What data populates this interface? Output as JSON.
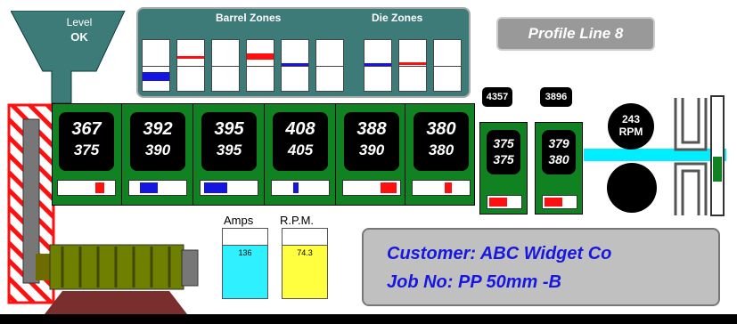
{
  "hopper": {
    "label": "Level",
    "status": "OK"
  },
  "zones_panel": {
    "barrel_label": "Barrel Zones",
    "die_label": "Die Zones"
  },
  "title": "Profile Line 8",
  "barrel_zones": [
    {
      "actual": "367",
      "setpoint": "375",
      "output_level": 0.12
    },
    {
      "actual": "392",
      "setpoint": "390",
      "output_level": 0.3
    },
    {
      "actual": "395",
      "setpoint": "395",
      "output_level": 0.38
    },
    {
      "actual": "408",
      "setpoint": "405",
      "output_level": 0.1
    },
    {
      "actual": "388",
      "setpoint": "390",
      "output_level": 0.28
    },
    {
      "actual": "380",
      "setpoint": "380",
      "output_level": 0.12
    }
  ],
  "die_zones": [
    {
      "pressure": "4357",
      "actual": "375",
      "setpoint": "375"
    },
    {
      "pressure": "3896",
      "actual": "379",
      "setpoint": "380"
    }
  ],
  "screw_speed": {
    "value": "243",
    "unit": "RPM"
  },
  "meters": [
    {
      "label": "Amps",
      "value": "136",
      "level": 0.74,
      "color": "#2ef0ff"
    },
    {
      "label": "R.P.M.",
      "value": "74.3",
      "level": 0.74,
      "color": "#ffff40"
    }
  ],
  "info": {
    "customer": "Customer:  ABC Widget Co",
    "job": "Job No: PP 50mm -B"
  },
  "colors": {
    "barrel": "#118221",
    "panel": "#3c7b78",
    "heat": "#ff1010",
    "cool": "#1515e0",
    "info_text": "#1717e0"
  }
}
